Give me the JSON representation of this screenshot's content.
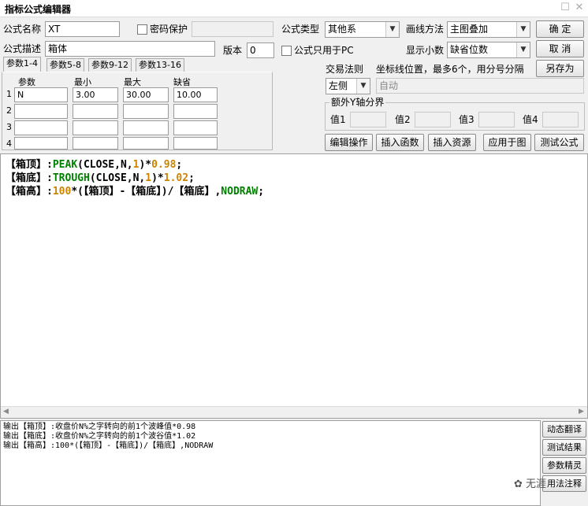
{
  "window": {
    "title": "指标公式编辑器",
    "restore_glyph": "☐",
    "close_glyph": "✕"
  },
  "form": {
    "name_label": "公式名称",
    "name_value": "XT",
    "password_label": "密码保护",
    "desc_label": "公式描述",
    "desc_value": "箱体",
    "version_label": "版本",
    "version_value": "0",
    "pc_only_label": "公式只用于PC",
    "type_label": "公式类型",
    "type_value": "其他系",
    "draw_label": "画线方法",
    "draw_value": "主图叠加",
    "decimals_label": "显示小数",
    "decimals_value": "缺省位数",
    "trade_rule_label": "交易法则",
    "trade_rule_value": "左侧",
    "coord_label": "坐标线位置，最多6个，用分号分隔",
    "coord_value": "自动",
    "yaxis_group_label": "额外Y轴分界",
    "yaxis_values": [
      "值1",
      "值2",
      "值3",
      "值4"
    ]
  },
  "buttons": {
    "ok": "确  定",
    "cancel": "取  消",
    "save_as": "另存为",
    "edit_ops": "编辑操作",
    "insert_fn": "插入函数",
    "insert_res": "插入资源",
    "apply_chart": "应用于图",
    "test_formula": "测试公式"
  },
  "tabs": [
    "参数1-4",
    "参数5-8",
    "参数9-12",
    "参数13-16"
  ],
  "params": {
    "headers": [
      "参数",
      "最小",
      "最大",
      "缺省"
    ],
    "rows": [
      {
        "idx": "1",
        "name": "N",
        "min": "3.00",
        "max": "30.00",
        "default": "10.00"
      },
      {
        "idx": "2",
        "name": "",
        "min": "",
        "max": "",
        "default": ""
      },
      {
        "idx": "3",
        "name": "",
        "min": "",
        "max": "",
        "default": ""
      },
      {
        "idx": "4",
        "name": "",
        "min": "",
        "max": "",
        "default": ""
      }
    ]
  },
  "code": {
    "line1": {
      "name": "【箱顶】",
      "sep": ":",
      "fn": "PEAK",
      "args": "(CLOSE,N,",
      "n1": "1",
      "mid": ")*",
      "n2": "0.98",
      "end": ";"
    },
    "line2": {
      "name": "【箱底】",
      "sep": ":",
      "fn": "TROUGH",
      "args": "(CLOSE,N,",
      "n1": "1",
      "mid": ")*",
      "n2": "1.02",
      "end": ";"
    },
    "line3": {
      "name": "【箱高】",
      "sep": ":",
      "n1": "100",
      "expr": "*(【箱顶】-【箱底】)/【箱底】,",
      "fn": "NODRAW",
      "end": ";"
    }
  },
  "output_lines": [
    "输出【箱顶】:收盘价N%之字转向的前1个波峰值*0.98",
    "输出【箱底】:收盘价N%之字转向的前1个波谷值*1.02",
    "输出【箱高】:100*(【箱顶】-【箱底】)/【箱底】,NODRAW"
  ],
  "side_buttons": [
    "动态翻译",
    "测试结果",
    "参数精灵",
    "用法注释"
  ],
  "watermark": "无涯",
  "colors": {
    "function": "#008000",
    "number": "#cc8400"
  }
}
